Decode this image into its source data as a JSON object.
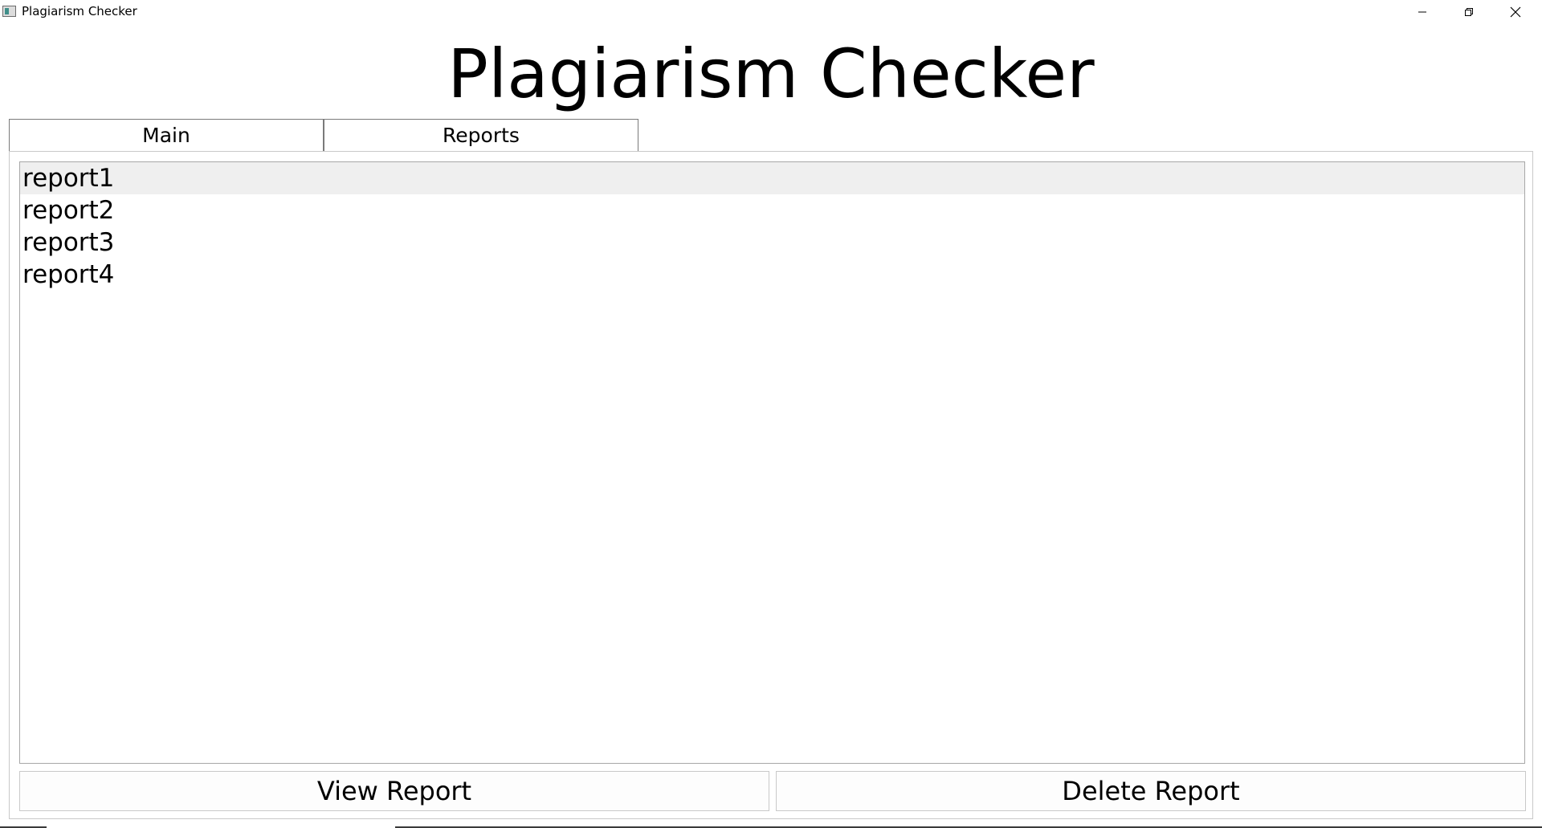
{
  "window": {
    "title": "Plagiarism Checker"
  },
  "heading": "Plagiarism Checker",
  "tabs": [
    {
      "label": "Main",
      "active": false
    },
    {
      "label": "Reports",
      "active": true
    }
  ],
  "reports_list": {
    "items": [
      "report1",
      "report2",
      "report3",
      "report4"
    ],
    "selected_index": 0
  },
  "buttons": {
    "view_label": "View Report",
    "delete_label": "Delete Report"
  },
  "icons": {
    "app": "app-icon",
    "minimize": "minimize-icon",
    "restore": "restore-icon",
    "close": "close-icon"
  }
}
